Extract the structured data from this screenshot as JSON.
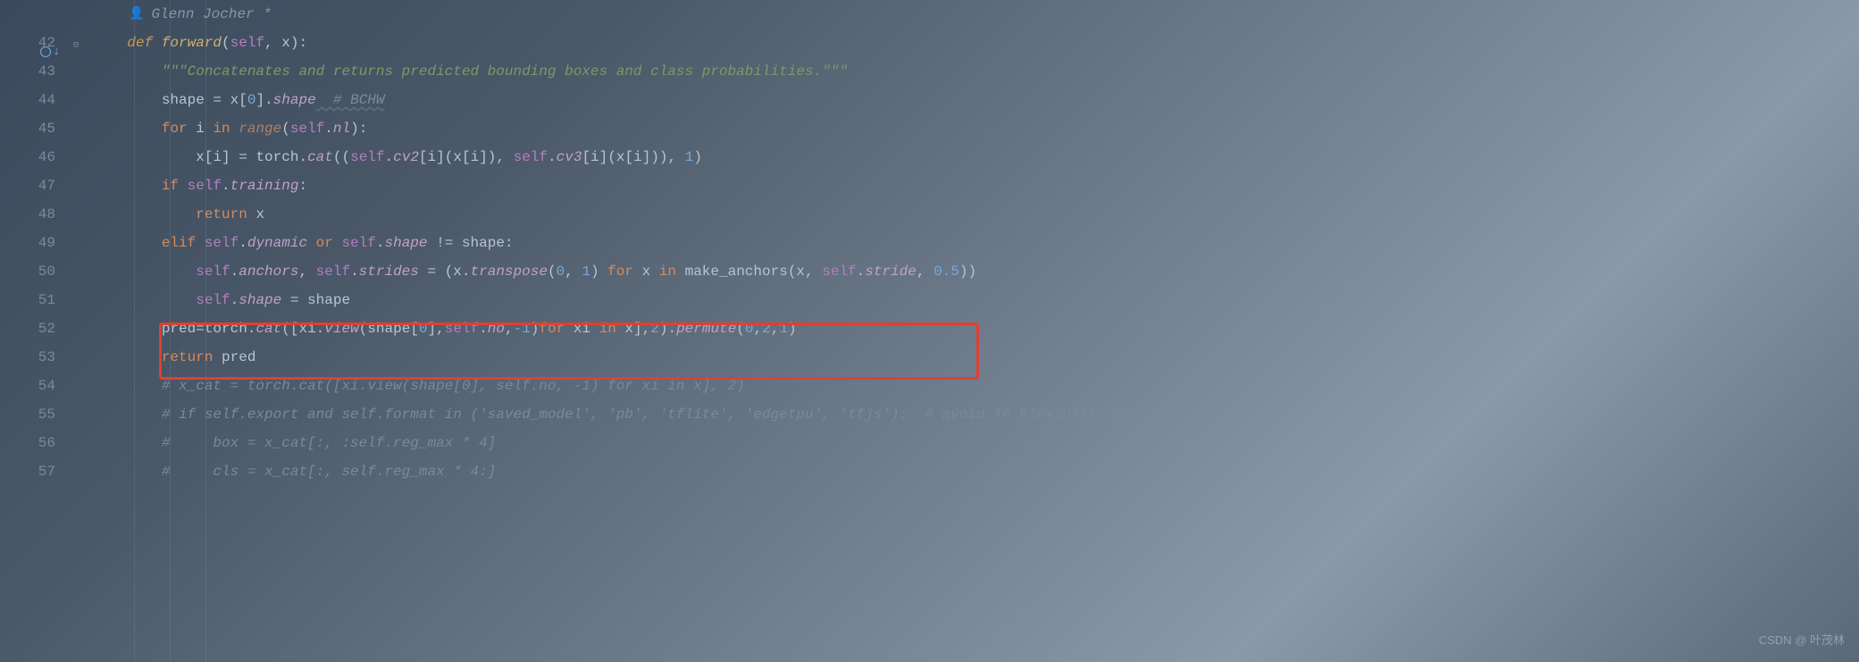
{
  "annotation": {
    "author": "Glenn Jocher *"
  },
  "line_numbers": [
    "42",
    "43",
    "44",
    "45",
    "46",
    "47",
    "48",
    "49",
    "50",
    "51",
    "52",
    "53",
    "54",
    "55",
    "56",
    "57"
  ],
  "code": {
    "l42": {
      "kw_def": "def ",
      "fn": "forward",
      "paren_open": "(",
      "self": "self",
      "comma": ", ",
      "param": "x",
      "paren_close": ")",
      "colon": ":"
    },
    "l43": {
      "docstring": "\"\"\"Concatenates and returns predicted bounding boxes and class probabilities.\"\"\""
    },
    "l44": {
      "shape": "shape ",
      "eq": "= ",
      "x": "x",
      "bracket_open": "[",
      "zero": "0",
      "bracket_close": "]",
      "dot": ".",
      "attr": "shape",
      "comment": "  # BCHW"
    },
    "l45": {
      "for": "for ",
      "i": "i ",
      "in": "in ",
      "range": "range",
      "paren_open": "(",
      "self": "self",
      "dot": ".",
      "nl": "nl",
      "paren_close": ")",
      "colon": ":"
    },
    "l46": {
      "x": "x",
      "bo1": "[",
      "i1": "i",
      "bc1": "] ",
      "eq": "= ",
      "torch": "torch",
      "dot1": ".",
      "cat": "cat",
      "po": "((",
      "self1": "self",
      "dot2": ".",
      "cv2": "cv2",
      "bo2": "[",
      "i2": "i",
      "bc2": "]",
      "po2": "(",
      "x2": "x",
      "bo3": "[",
      "i3": "i",
      "bc3": "]",
      "pc2": ")",
      "comma": ", ",
      "self2": "self",
      "dot3": ".",
      "cv3": "cv3",
      "bo4": "[",
      "i4": "i",
      "bc4": "]",
      "po3": "(",
      "x3": "x",
      "bo5": "[",
      "i5": "i",
      "bc5": "]",
      "pc3": "))",
      "comma2": ", ",
      "one": "1",
      "pc": ")"
    },
    "l47": {
      "if": "if ",
      "self": "self",
      "dot": ".",
      "training": "training",
      "colon": ":"
    },
    "l48": {
      "return": "return ",
      "x": "x"
    },
    "l49": {
      "elif": "elif ",
      "self1": "self",
      "dot1": ".",
      "dynamic": "dynamic ",
      "or": "or ",
      "self2": "self",
      "dot2": ".",
      "shape1": "shape ",
      "ne": "!= ",
      "shape2": "shape",
      "colon": ":"
    },
    "l50": {
      "self1": "self",
      "dot1": ".",
      "anchors": "anchors",
      "comma1": ", ",
      "self2": "self",
      "dot2": ".",
      "strides": "strides ",
      "eq": "= ",
      "po": "(",
      "x1": "x",
      "dot3": ".",
      "transpose": "transpose",
      "po2": "(",
      "zero": "0",
      "comma2": ", ",
      "one": "1",
      "pc2": ") ",
      "for": "for ",
      "x2": "x ",
      "in": "in ",
      "make_anchors": "make_anchors",
      "po3": "(",
      "x3": "x",
      "comma3": ", ",
      "self3": "self",
      "dot4": ".",
      "stride": "stride",
      "comma4": ", ",
      "half": "0.5",
      "pc3": "))"
    },
    "l51": {
      "self": "self",
      "dot": ".",
      "shape1": "shape ",
      "eq": "= ",
      "shape2": "shape"
    },
    "l52": {
      "pred": "pred",
      "eq": "=",
      "torch": "torch",
      "dot1": ".",
      "cat": "cat",
      "po": "([",
      "xi1": "xi",
      "dot2": ".",
      "view": "view",
      "po2": "(",
      "shape": "shape",
      "bo": "[",
      "zero": "0",
      "bc": "]",
      "comma1": ",",
      "self": "self",
      "dot3": ".",
      "no": "no",
      "comma2": ",",
      "neg1": "-1",
      "pc2": ")",
      "for": "for ",
      "xi2": "xi ",
      "in": "in ",
      "x": "x",
      "pc": "]",
      "comma3": ",",
      "two": "2",
      "pc3": ")",
      "dot4": ".",
      "permute": "permute",
      "po3": "(",
      "zero2": "0",
      "comma4": ",",
      "two2": "2",
      "comma5": ",",
      "one": "1",
      "pc4": ")"
    },
    "l53": {
      "return": "return ",
      "pred": "pred"
    },
    "l54": {
      "comment": "# x_cat = torch.cat([xi.view(shape[0], self.no, -1) for xi in x], 2)"
    },
    "l55": {
      "comment": "# if self.export and self.format in ('saved_model', 'pb', 'tflite', 'edgetpu', 'tfjs'):  # avoid TF FlexSplitV ops"
    },
    "l56": {
      "comment": "#     box = x_cat[:, :self.reg_max * 4]"
    },
    "l57": {
      "comment": "#     cls = x_cat[:, self.reg_max * 4:]"
    }
  },
  "watermark": "CSDN @ 叶茂林"
}
